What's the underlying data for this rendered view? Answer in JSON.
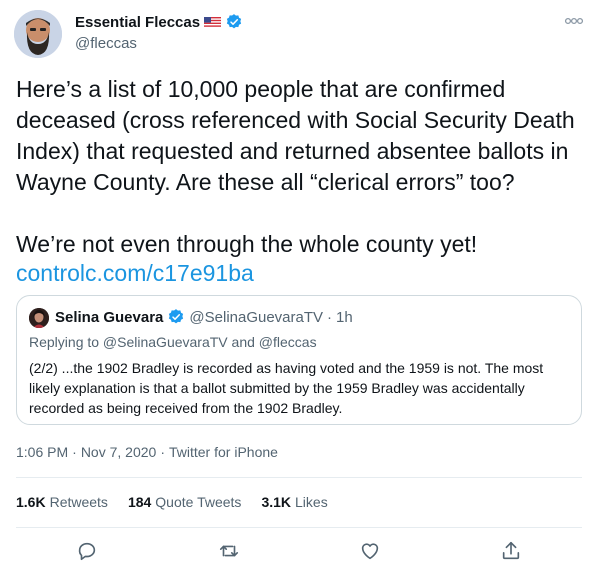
{
  "author": {
    "name": "Essential Fleccas",
    "handle": "@fleccas",
    "verified_color": "#1d9bf0"
  },
  "tweet": {
    "text": "Here’s a list of 10,000 people that are confirmed deceased (cross referenced with Social Security Death Index) that requested and returned absentee ballots in Wayne County. Are these all “clerical errors” too?\n\nWe’re not even through the whole county yet!",
    "link": "controlc.com/c17e91ba",
    "time": "1:06 PM",
    "date": "Nov 7, 2020",
    "client": "Twitter for iPhone",
    "dot": "·"
  },
  "quote": {
    "name": "Selina Guevara",
    "handle": "@SelinaGuevaraTV",
    "dot": "·",
    "time": "1h",
    "replying": "Replying to @SelinaGuevaraTV and @fleccas",
    "text": "(2/2) ...the 1902 Bradley is recorded as having voted and the 1959 is not. The most likely explanation is that a ballot submitted by the 1959 Bradley was accidentally recorded as being received from the 1902 Bradley."
  },
  "stats": {
    "retweets_count": "1.6K",
    "retweets_label": "Retweets",
    "quotes_count": "184",
    "quotes_label": "Quote Tweets",
    "likes_count": "3.1K",
    "likes_label": "Likes"
  },
  "colors": {
    "text": "#0f1419",
    "secondary": "#536471",
    "link": "#1b95e0",
    "border": "#cfd9de"
  },
  "icons": [
    "more-icon",
    "verified-badge-icon",
    "us-flag-icon",
    "reply-icon",
    "retweet-icon",
    "like-icon",
    "share-icon"
  ]
}
